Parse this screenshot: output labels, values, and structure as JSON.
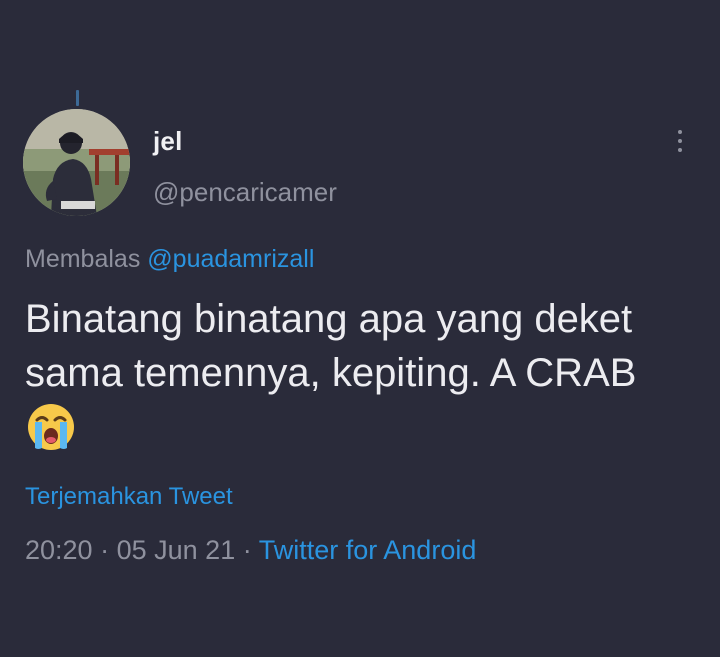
{
  "tweet": {
    "author": {
      "display_name": "jel",
      "handle": "@pencaricamer",
      "avatar_icon": "profile-photo-avatar"
    },
    "more_icon": "more-vertical-icon",
    "reply_to": {
      "prefix": "Membalas",
      "mention": "@puadamrizall"
    },
    "text_line_1": "Binatang binatang apa yang deket",
    "text_line_2": "sama temennya, kepiting. A CRAB",
    "emoji": "loudly-crying-face-emoji",
    "translate_label": "Terjemahkan Tweet",
    "time": "20:20",
    "separator_1": "·",
    "date": "05 Jun 21",
    "separator_2": "·",
    "client": "Twitter for Android"
  },
  "colors": {
    "background": "#2a2b3a",
    "link_blue": "#2a94e0",
    "secondary_text": "#8f919e",
    "primary_text": "#ececf0"
  }
}
